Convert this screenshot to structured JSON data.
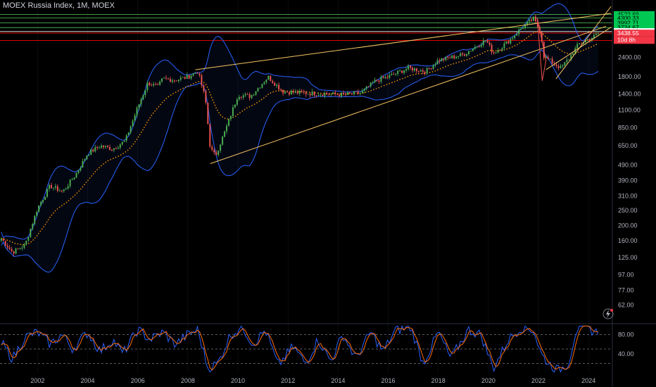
{
  "header": {
    "title": "MOEX Russia Index, 1M, MOEX"
  },
  "colors": {
    "up": "#26a69a",
    "up_bright": "#4caf50",
    "down": "#ef5350",
    "bollinger": "#2962ff",
    "ema": "#ff9800",
    "trendline": "#f7c463",
    "grid": "#2a2e39",
    "stoch_k": "#2962ff",
    "stoch_d": "#ff6d00"
  },
  "chart_data": [
    {
      "type": "candlestick",
      "title": "MOEX Russia Index, 1M, MOEX",
      "y_scale": "log",
      "ylim": [
        48,
        5600
      ],
      "xlim": [
        2000.5,
        2024.95
      ],
      "x_ticks": [
        "2002",
        "2004",
        "2006",
        "2008",
        "2010",
        "2012",
        "2014",
        "2016",
        "2018",
        "2020",
        "2022",
        "2024"
      ],
      "y_ticks": [
        "2400.00",
        "1800.00",
        "1400.00",
        "1100.00",
        "850.00",
        "650.00",
        "490.00",
        "390.00",
        "310.00",
        "250.00",
        "200.00",
        "160.00",
        "125.00",
        "97.00",
        "77.00",
        "62.00"
      ],
      "anchors": [
        {
          "t": 2000.55,
          "p": 165
        },
        {
          "t": 2001.0,
          "p": 135
        },
        {
          "t": 2001.5,
          "p": 150
        },
        {
          "t": 2002.0,
          "p": 260
        },
        {
          "t": 2002.5,
          "p": 360
        },
        {
          "t": 2003.0,
          "p": 330
        },
        {
          "t": 2003.5,
          "p": 420
        },
        {
          "t": 2004.0,
          "p": 580
        },
        {
          "t": 2004.5,
          "p": 650
        },
        {
          "t": 2005.0,
          "p": 620
        },
        {
          "t": 2005.5,
          "p": 700
        },
        {
          "t": 2006.0,
          "p": 1150
        },
        {
          "t": 2006.4,
          "p": 1650
        },
        {
          "t": 2006.8,
          "p": 1550
        },
        {
          "t": 2007.0,
          "p": 1750
        },
        {
          "t": 2007.5,
          "p": 1720
        },
        {
          "t": 2008.0,
          "p": 1800
        },
        {
          "t": 2008.4,
          "p": 1950
        },
        {
          "t": 2008.7,
          "p": 1300
        },
        {
          "t": 2008.9,
          "p": 620
        },
        {
          "t": 2009.1,
          "p": 560
        },
        {
          "t": 2009.5,
          "p": 820
        },
        {
          "t": 2010.0,
          "p": 1380
        },
        {
          "t": 2010.5,
          "p": 1350
        },
        {
          "t": 2011.2,
          "p": 1800
        },
        {
          "t": 2011.8,
          "p": 1450
        },
        {
          "t": 2012.5,
          "p": 1420
        },
        {
          "t": 2013.5,
          "p": 1400
        },
        {
          "t": 2014.2,
          "p": 1380
        },
        {
          "t": 2014.9,
          "p": 1420
        },
        {
          "t": 2015.5,
          "p": 1700
        },
        {
          "t": 2016.0,
          "p": 1800
        },
        {
          "t": 2016.8,
          "p": 2050
        },
        {
          "t": 2017.5,
          "p": 1950
        },
        {
          "t": 2018.0,
          "p": 2300
        },
        {
          "t": 2019.0,
          "p": 2500
        },
        {
          "t": 2019.9,
          "p": 3100
        },
        {
          "t": 2020.2,
          "p": 2550
        },
        {
          "t": 2020.8,
          "p": 3050
        },
        {
          "t": 2021.4,
          "p": 3800
        },
        {
          "t": 2021.8,
          "p": 4250
        },
        {
          "t": 2022.1,
          "p": 3450
        },
        {
          "t": 2022.2,
          "p": 2450
        },
        {
          "t": 2022.6,
          "p": 2200
        },
        {
          "t": 2022.9,
          "p": 2050
        },
        {
          "t": 2023.2,
          "p": 2350
        },
        {
          "t": 2023.6,
          "p": 2900
        },
        {
          "t": 2023.9,
          "p": 3100
        },
        {
          "t": 2024.2,
          "p": 3250
        },
        {
          "t": 2024.4,
          "p": 3438.55
        }
      ],
      "horizontal_levels": [
        {
          "value": 4522.69,
          "label": "4522.69",
          "color": "#4caf50"
        },
        {
          "value": 4300.33,
          "label": "4300.33",
          "color": "#4caf50"
        },
        {
          "value": 3992.71,
          "label": "3992.71",
          "color": "#4caf50"
        },
        {
          "value": 3724.67,
          "label": "3724.67",
          "color": "#4caf50"
        },
        {
          "value": 3515.87,
          "label": "3515.87",
          "color": "#ffffff"
        },
        {
          "value": 3438.55,
          "label": "3438.55",
          "color": "#ff0000"
        },
        {
          "value": 3079.14,
          "label": "3079.14",
          "color": "#ff0000"
        }
      ],
      "countdown_label": "10d 8h",
      "trendlines": [
        {
          "from": [
            2008.9,
            500
          ],
          "to": [
            2024.7,
            3800
          ]
        },
        {
          "from": [
            2008.3,
            2000
          ],
          "to": [
            2024.9,
            4600
          ]
        },
        {
          "from": [
            2022.3,
            2000
          ],
          "to": [
            2024.9,
            3750
          ]
        },
        {
          "from": [
            2022.7,
            1750
          ],
          "to": [
            2024.9,
            5100
          ]
        }
      ],
      "triangle_2022": [
        [
          2021.95,
          4300
        ],
        [
          2022.15,
          1700
        ],
        [
          2022.3,
          2300
        ]
      ]
    },
    {
      "type": "line",
      "title": "",
      "ylim": [
        0,
        100
      ],
      "y_ticks": [
        "80.00",
        "40.00"
      ],
      "levels": [
        80,
        50,
        20
      ],
      "anchors": [
        {
          "t": 2000.6,
          "v": 60
        },
        {
          "t": 2001.0,
          "v": 30
        },
        {
          "t": 2001.5,
          "v": 75
        },
        {
          "t": 2002.0,
          "v": 85
        },
        {
          "t": 2002.5,
          "v": 60
        },
        {
          "t": 2003.0,
          "v": 80
        },
        {
          "t": 2003.4,
          "v": 50
        },
        {
          "t": 2004.0,
          "v": 85
        },
        {
          "t": 2004.5,
          "v": 45
        },
        {
          "t": 2005.0,
          "v": 70
        },
        {
          "t": 2005.4,
          "v": 40
        },
        {
          "t": 2006.0,
          "v": 90
        },
        {
          "t": 2006.5,
          "v": 70
        },
        {
          "t": 2007.0,
          "v": 85
        },
        {
          "t": 2007.5,
          "v": 60
        },
        {
          "t": 2008.0,
          "v": 80
        },
        {
          "t": 2008.4,
          "v": 90
        },
        {
          "t": 2008.8,
          "v": 10
        },
        {
          "t": 2009.2,
          "v": 20
        },
        {
          "t": 2009.7,
          "v": 80
        },
        {
          "t": 2010.2,
          "v": 95
        },
        {
          "t": 2010.6,
          "v": 60
        },
        {
          "t": 2011.1,
          "v": 90
        },
        {
          "t": 2011.6,
          "v": 15
        },
        {
          "t": 2012.2,
          "v": 55
        },
        {
          "t": 2012.7,
          "v": 20
        },
        {
          "t": 2013.2,
          "v": 70
        },
        {
          "t": 2013.7,
          "v": 25
        },
        {
          "t": 2014.2,
          "v": 80
        },
        {
          "t": 2014.7,
          "v": 30
        },
        {
          "t": 2015.3,
          "v": 85
        },
        {
          "t": 2015.8,
          "v": 45
        },
        {
          "t": 2016.3,
          "v": 90
        },
        {
          "t": 2016.9,
          "v": 95
        },
        {
          "t": 2017.4,
          "v": 20
        },
        {
          "t": 2018.0,
          "v": 85
        },
        {
          "t": 2018.5,
          "v": 30
        },
        {
          "t": 2019.2,
          "v": 90
        },
        {
          "t": 2019.7,
          "v": 80
        },
        {
          "t": 2020.2,
          "v": 10
        },
        {
          "t": 2020.8,
          "v": 70
        },
        {
          "t": 2021.3,
          "v": 95
        },
        {
          "t": 2021.8,
          "v": 90
        },
        {
          "t": 2022.1,
          "v": 40
        },
        {
          "t": 2022.4,
          "v": 20
        },
        {
          "t": 2022.8,
          "v": 5
        },
        {
          "t": 2023.2,
          "v": 20
        },
        {
          "t": 2023.5,
          "v": 90
        },
        {
          "t": 2023.9,
          "v": 95
        },
        {
          "t": 2024.3,
          "v": 85
        },
        {
          "t": 2024.4,
          "v": 88
        }
      ]
    }
  ]
}
